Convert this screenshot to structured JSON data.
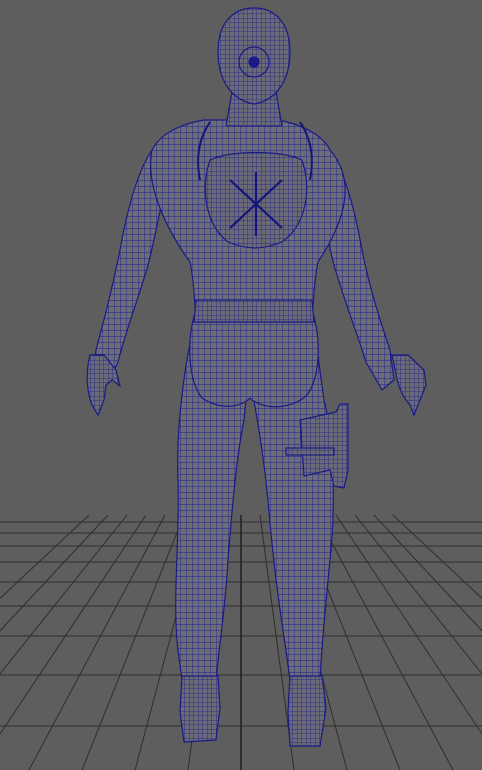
{
  "viewport": {
    "view": "back",
    "display_mode": "wireframe-on-shaded",
    "background_color": "#5e5e5e",
    "grid_color": "#2f2f2f",
    "mesh_fill_color": "#6e6e76",
    "wireframe_color": "#1f1f8f"
  },
  "model": {
    "parts": [
      "head",
      "hair-bun",
      "neck",
      "torso",
      "back-emblem",
      "belt",
      "left-arm",
      "right-arm",
      "left-hand",
      "right-hand",
      "left-leg",
      "right-leg",
      "left-boot",
      "right-boot",
      "thigh-holster"
    ]
  }
}
